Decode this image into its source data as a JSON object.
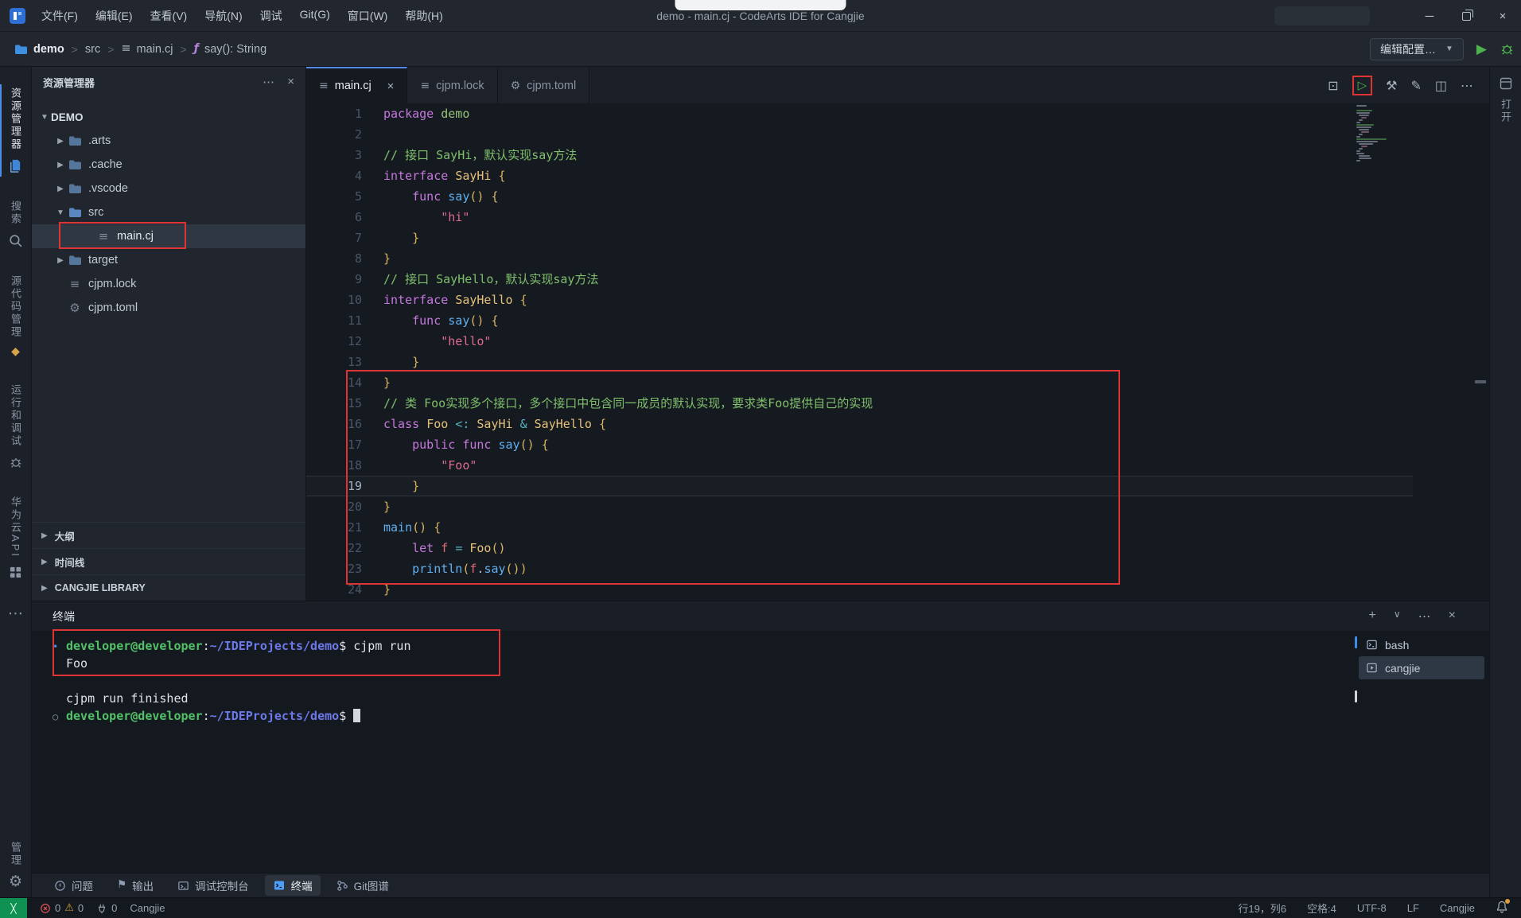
{
  "titlebar": {
    "menus": [
      "文件(F)",
      "编辑(E)",
      "查看(V)",
      "导航(N)",
      "调试",
      "Git(G)",
      "窗口(W)",
      "帮助(H)"
    ],
    "title": "demo - main.cj - CodeArts IDE for Cangjie"
  },
  "breadcrumb": {
    "items": [
      {
        "label": "demo",
        "icon": "folder-accent",
        "bold": true
      },
      {
        "label": "src",
        "icon": ""
      },
      {
        "label": "main.cj",
        "icon": "file-lines"
      },
      {
        "label": "say(): String",
        "icon": "symbol-method"
      }
    ],
    "run_config_label": "编辑配置…"
  },
  "activitybar": {
    "items": [
      {
        "label": "资源管理器",
        "icon": "files",
        "active": true
      },
      {
        "label": "搜索",
        "icon": "search"
      },
      {
        "label": "源代码管理",
        "icon": "scm-diamond"
      },
      {
        "label": "运行和调试",
        "icon": "debug"
      },
      {
        "label": "华为云API",
        "icon": "api-grid"
      },
      {
        "label": "",
        "icon": "more"
      }
    ],
    "bottom": {
      "label": "管理"
    }
  },
  "explorer": {
    "title": "资源管理器",
    "tree": [
      {
        "label": "DEMO",
        "level": 0,
        "arrow": "▼",
        "icon": "",
        "bold": true
      },
      {
        "label": ".arts",
        "level": 1,
        "arrow": "▶",
        "icon": "folder"
      },
      {
        "label": ".cache",
        "level": 1,
        "arrow": "▶",
        "icon": "folder"
      },
      {
        "label": ".vscode",
        "level": 1,
        "arrow": "▶",
        "icon": "folder"
      },
      {
        "label": "src",
        "level": 1,
        "arrow": "▼",
        "icon": "folder-src"
      },
      {
        "label": "main.cj",
        "level": 2,
        "arrow": "",
        "icon": "file-lines",
        "selected": true
      },
      {
        "label": "target",
        "level": 1,
        "arrow": "▶",
        "icon": "folder"
      },
      {
        "label": "cjpm.lock",
        "level": 1,
        "arrow": "",
        "icon": "file-lines"
      },
      {
        "label": "cjpm.toml",
        "level": 1,
        "arrow": "",
        "icon": "file-gear"
      }
    ],
    "sections": [
      "大纲",
      "时间线",
      "CANGJIE LIBRARY"
    ]
  },
  "editor": {
    "tabs": [
      {
        "label": "main.cj",
        "icon": "file-lines",
        "active": true,
        "closable": true
      },
      {
        "label": "cjpm.lock",
        "icon": "file-lines"
      },
      {
        "label": "cjpm.toml",
        "icon": "file-gear"
      }
    ],
    "cursor_line": 19,
    "code": [
      [
        [
          "k",
          "package"
        ],
        [
          "p",
          " "
        ],
        [
          "d",
          "demo"
        ]
      ],
      [],
      [
        [
          "c",
          "// 接口 SayHi，默认实现say方法"
        ]
      ],
      [
        [
          "k",
          "interface"
        ],
        [
          "p",
          " "
        ],
        [
          "t",
          "SayHi"
        ],
        [
          "p",
          " "
        ],
        [
          "b",
          "{"
        ]
      ],
      [
        [
          "p",
          "    "
        ],
        [
          "k",
          "func"
        ],
        [
          "p",
          " "
        ],
        [
          "f",
          "say"
        ],
        [
          "b",
          "()"
        ],
        [
          "p",
          " "
        ],
        [
          "b",
          "{"
        ]
      ],
      [
        [
          "p",
          "        "
        ],
        [
          "s",
          "\"hi\""
        ]
      ],
      [
        [
          "p",
          "    "
        ],
        [
          "b",
          "}"
        ]
      ],
      [
        [
          "b",
          "}"
        ]
      ],
      [
        [
          "c",
          "// 接口 SayHello，默认实现say方法"
        ]
      ],
      [
        [
          "k",
          "interface"
        ],
        [
          "p",
          " "
        ],
        [
          "t",
          "SayHello"
        ],
        [
          "p",
          " "
        ],
        [
          "b",
          "{"
        ]
      ],
      [
        [
          "p",
          "    "
        ],
        [
          "k",
          "func"
        ],
        [
          "p",
          " "
        ],
        [
          "f",
          "say"
        ],
        [
          "b",
          "()"
        ],
        [
          "p",
          " "
        ],
        [
          "b",
          "{"
        ]
      ],
      [
        [
          "p",
          "        "
        ],
        [
          "s",
          "\"hello\""
        ]
      ],
      [
        [
          "p",
          "    "
        ],
        [
          "b",
          "}"
        ]
      ],
      [
        [
          "b",
          "}"
        ]
      ],
      [
        [
          "c",
          "// 类 Foo实现多个接口，多个接口中包含同一成员的默认实现，要求类Foo提供自己的实现"
        ]
      ],
      [
        [
          "k",
          "class"
        ],
        [
          "p",
          " "
        ],
        [
          "t",
          "Foo"
        ],
        [
          "p",
          " "
        ],
        [
          "o",
          "<:"
        ],
        [
          "p",
          " "
        ],
        [
          "t",
          "SayHi"
        ],
        [
          "p",
          " "
        ],
        [
          "o",
          "&"
        ],
        [
          "p",
          " "
        ],
        [
          "t",
          "SayHello"
        ],
        [
          "p",
          " "
        ],
        [
          "b",
          "{"
        ]
      ],
      [
        [
          "p",
          "    "
        ],
        [
          "k",
          "public"
        ],
        [
          "p",
          " "
        ],
        [
          "k",
          "func"
        ],
        [
          "p",
          " "
        ],
        [
          "f",
          "say"
        ],
        [
          "b",
          "()"
        ],
        [
          "p",
          " "
        ],
        [
          "b",
          "{"
        ]
      ],
      [
        [
          "p",
          "        "
        ],
        [
          "s",
          "\"Foo\""
        ]
      ],
      [
        [
          "p",
          "    "
        ],
        [
          "b",
          "}"
        ]
      ],
      [
        [
          "b",
          "}"
        ]
      ],
      [
        [
          "f",
          "main"
        ],
        [
          "b",
          "()"
        ],
        [
          "p",
          " "
        ],
        [
          "b",
          "{"
        ]
      ],
      [
        [
          "p",
          "    "
        ],
        [
          "k",
          "let"
        ],
        [
          "p",
          " "
        ],
        [
          "v",
          "f"
        ],
        [
          "p",
          " "
        ],
        [
          "o",
          "="
        ],
        [
          "p",
          " "
        ],
        [
          "t",
          "Foo"
        ],
        [
          "b",
          "()"
        ]
      ],
      [
        [
          "p",
          "    "
        ],
        [
          "f",
          "println"
        ],
        [
          "b",
          "("
        ],
        [
          "v",
          "f"
        ],
        [
          "p",
          "."
        ],
        [
          "f",
          "say"
        ],
        [
          "b",
          "()"
        ],
        [
          "b",
          ")"
        ]
      ],
      [
        [
          "b",
          "}"
        ]
      ]
    ]
  },
  "right_strip": {
    "label": "打开"
  },
  "terminal": {
    "title": "终端",
    "lines": [
      {
        "deco": "blue",
        "tokens": [
          [
            "g",
            "developer@developer"
          ],
          [
            "w",
            ":"
          ],
          [
            "b",
            "~/IDEProjects/demo"
          ],
          [
            "w",
            "$ cjpm run"
          ]
        ]
      },
      {
        "deco": "",
        "tokens": [
          [
            "w",
            "Foo"
          ]
        ]
      },
      {
        "deco": "",
        "tokens": []
      },
      {
        "deco": "",
        "tokens": [
          [
            "w",
            "cjpm run finished"
          ]
        ]
      },
      {
        "deco": "grey",
        "tokens": [
          [
            "g",
            "developer@developer"
          ],
          [
            "w",
            ":"
          ],
          [
            "b",
            "~/IDEProjects/demo"
          ],
          [
            "w",
            "$ "
          ],
          [
            "cursor",
            ""
          ]
        ]
      }
    ],
    "instances": [
      {
        "label": "bash",
        "icon": "term-plain"
      },
      {
        "label": "cangjie",
        "icon": "term-run",
        "active": true
      }
    ]
  },
  "panel_tabs": [
    {
      "label": "问题",
      "icon": "problems"
    },
    {
      "label": "输出",
      "icon": "output"
    },
    {
      "label": "调试控制台",
      "icon": "debug-console"
    },
    {
      "label": "终端",
      "icon": "terminal",
      "active": true
    },
    {
      "label": "Git图谱",
      "icon": "git-graph"
    }
  ],
  "statusbar": {
    "errors": "0",
    "warnings": "0",
    "ports": "0",
    "lang": "Cangjie",
    "right": [
      "行19，列6",
      "空格:4",
      "UTF-8",
      "LF",
      "Cangjie"
    ]
  }
}
